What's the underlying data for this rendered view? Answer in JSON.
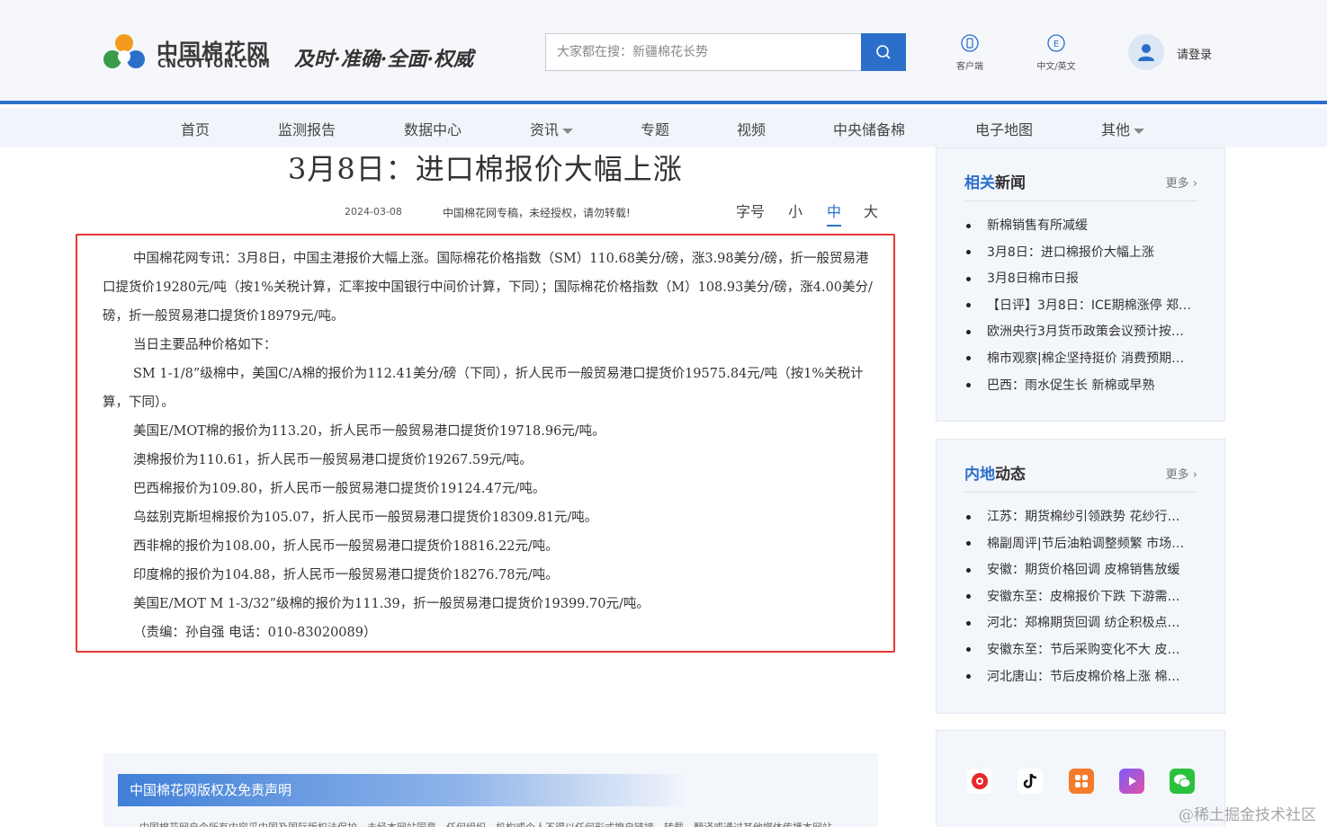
{
  "header": {
    "logo_cn": "中国棉花网",
    "logo_en": "CNCOTTON.COM",
    "slogan": "及时·准确·全面·权威",
    "search_placeholder": "大家都在搜：新疆棉花长势",
    "tools": [
      {
        "label": "客户端",
        "icon": "mobile-icon"
      },
      {
        "label": "中文/英文",
        "icon": "language-icon"
      }
    ],
    "login_label": "请登录",
    "colors": {
      "accent": "#2b6fcb",
      "border_highlight": "#e53935"
    }
  },
  "nav": {
    "items": [
      "首页",
      "监测报告",
      "数据中心",
      "资讯",
      "专题",
      "视频",
      "中央储备棉",
      "电子地图",
      "其他"
    ]
  },
  "article": {
    "title": "3月8日：进口棉报价大幅上涨",
    "date": "2024-03-08",
    "source_note": "中国棉花网专稿，未经授权，请勿转载!",
    "fontsize_label": "字号",
    "fontsize_options": [
      "小",
      "中",
      "大"
    ],
    "fontsize_selected": "中",
    "paragraphs": [
      "中国棉花网专讯：3月8日，中国主港报价大幅上涨。国际棉花价格指数（SM）110.68美分/磅，涨3.98美分/磅，折一般贸易港口提货价19280元/吨（按1%关税计算，汇率按中国银行中间价计算，下同）；国际棉花价格指数（M）108.93美分/磅，涨4.00美分/磅，折一般贸易港口提货价18979元/吨。",
      "当日主要品种价格如下：",
      "SM 1-1/8”级棉中，美国C/A棉的报价为112.41美分/磅（下同），折人民币一般贸易港口提货价19575.84元/吨（按1%关税计算，下同）。",
      "美国E/MOT棉的报价为113.20，折人民币一般贸易港口提货价19718.96元/吨。",
      "澳棉报价为110.61，折人民币一般贸易港口提货价19267.59元/吨。",
      "巴西棉报价为109.80，折人民币一般贸易港口提货价19124.47元/吨。",
      "乌兹别克斯坦棉报价为105.07，折人民币一般贸易港口提货价18309.81元/吨。",
      "西非棉的报价为108.00，折人民币一般贸易港口提货价18816.22元/吨。",
      "印度棉的报价为104.88，折人民币一般贸易港口提货价18276.78元/吨。",
      "美国E/MOT M 1-3/32”级棉的报价为111.39，折一般贸易港口提货价19399.70元/吨。",
      "（责编：孙自强 电话：010-83020089）"
    ]
  },
  "related_news": {
    "title_blue": "相关",
    "title_rest": "新闻",
    "more": "更多",
    "items": [
      "新棉销售有所减缓",
      "3月8日：进口棉报价大幅上涨",
      "3月8日棉市日报",
      "【日评】3月8日：ICE期棉涨停 郑棉…",
      "欧洲央行3月货币政策会议预计按…",
      "棉市观察|棉企坚持挺价 消费预期…",
      "巴西：雨水促生长 新棉或早熟"
    ]
  },
  "inland_news": {
    "title_blue": "内地",
    "title_rest": "动态",
    "more": "更多",
    "items": [
      "江苏：期货棉纱引领跌势 花纱行…",
      "棉副周评|节后油粕调整频繁 市场…",
      "安徽：期货价格回调 皮棉销售放缓",
      "安徽东至：皮棉报价下跌 下游需…",
      "河北：郑棉期货回调 纺企积极点…",
      "安徽东至：节后采购变化不大 皮…",
      "河北唐山：节后皮棉价格上涨 棉…"
    ]
  },
  "social_icons": [
    "weibo-icon",
    "douyin-icon",
    "app-icon",
    "video-icon",
    "wechat-icon"
  ],
  "disclaimer": {
    "heading": "中国棉花网版权及免责声明",
    "text": "中国棉花网自今所有内容采中国及国际版权法保护，未经本网站同意，任何组织、机构或个人不得以任何形式擅自链接、转载、翻译或通过其他媒体传播本网站"
  },
  "watermark": "@稀土掘金技术社区"
}
